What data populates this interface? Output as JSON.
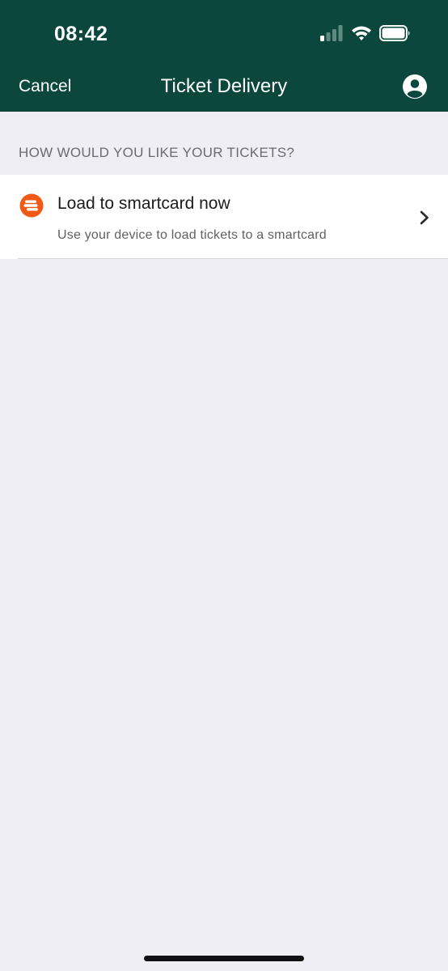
{
  "status_bar": {
    "time": "08:42"
  },
  "nav": {
    "cancel_label": "Cancel",
    "title": "Ticket Delivery",
    "account_icon": "account-icon"
  },
  "section": {
    "header": "HOW WOULD YOU LIKE YOUR TICKETS?"
  },
  "options": [
    {
      "title": "Load to smartcard now",
      "subtitle": "Use your device to load tickets to a smartcard",
      "icon": "smartcard-icon"
    }
  ],
  "colors": {
    "header_bg": "#0b473c",
    "page_bg": "#efeef4",
    "accent_orange": "#f05a14"
  }
}
